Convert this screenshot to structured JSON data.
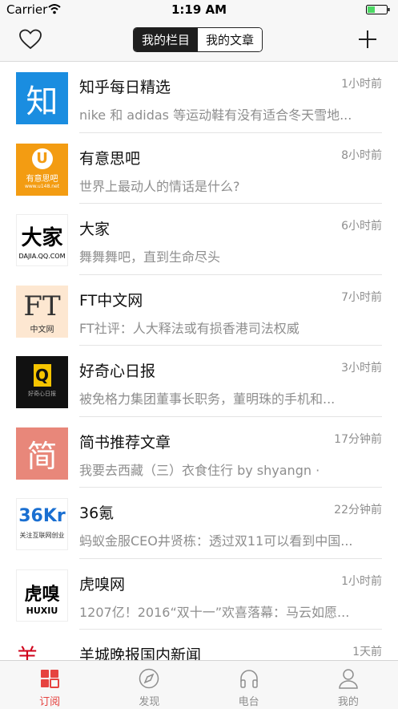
{
  "status": {
    "carrier": "Carrier",
    "time": "1:19 AM"
  },
  "nav": {
    "segments": [
      {
        "label": "我的栏目",
        "active": true
      },
      {
        "label": "我的文章",
        "active": false
      }
    ]
  },
  "list": [
    {
      "title": "知乎每日精选",
      "time": "1小时前",
      "sub": "nike 和 adidas 等运动鞋有没有适合冬天雪地...",
      "logo_text": "知"
    },
    {
      "title": "有意思吧",
      "time": "8小时前",
      "sub": "世界上最动人的情话是什么?",
      "logo_text": "有意思吧",
      "logo_sub": "www.u148.net"
    },
    {
      "title": "大家",
      "time": "6小时前",
      "sub": "舞舞舞吧，直到生命尽头",
      "logo_text": "大家",
      "logo_sub": "DAJIA.QQ.COM"
    },
    {
      "title": "FT中文网",
      "time": "7小时前",
      "sub": "FT社评：人大释法或有损香港司法权威",
      "logo_text": "FT",
      "logo_sub": "中文网"
    },
    {
      "title": "好奇心日报",
      "time": "3小时前",
      "sub": "被免格力集团董事长职务，董明珠的手机和...",
      "logo_text": "Q",
      "logo_sub": "好奇心日报"
    },
    {
      "title": "简书推荐文章",
      "time": "17分钟前",
      "sub": "我要去西藏（三）衣食住行 by shyangn ·",
      "logo_text": "简"
    },
    {
      "title": "36氪",
      "time": "22分钟前",
      "sub": "蚂蚁金服CEO井贤栋：透过双11可以看到中国...",
      "logo_text": "36Kr",
      "logo_sub": "关注互联网创业"
    },
    {
      "title": "虎嗅网",
      "time": "1小时前",
      "sub": "1207亿！2016“双十一”欢喜落幕：马云如愿...",
      "logo_text": "虎嗅",
      "logo_sub": "HUXIU"
    },
    {
      "title": "羊城晚报国内新闻",
      "time": "1天前",
      "sub": "",
      "logo_text": "羊"
    }
  ],
  "tabs": [
    {
      "label": "订阅",
      "icon": "subscribe-grid-icon",
      "active": true
    },
    {
      "label": "发现",
      "icon": "compass-icon",
      "active": false
    },
    {
      "label": "电台",
      "icon": "headphones-icon",
      "active": false
    },
    {
      "label": "我的",
      "icon": "person-icon",
      "active": false
    }
  ],
  "colors": {
    "accent": "#e64340",
    "bar_bg": "#f7f7f7",
    "secondary_text": "#8e8e8e"
  }
}
